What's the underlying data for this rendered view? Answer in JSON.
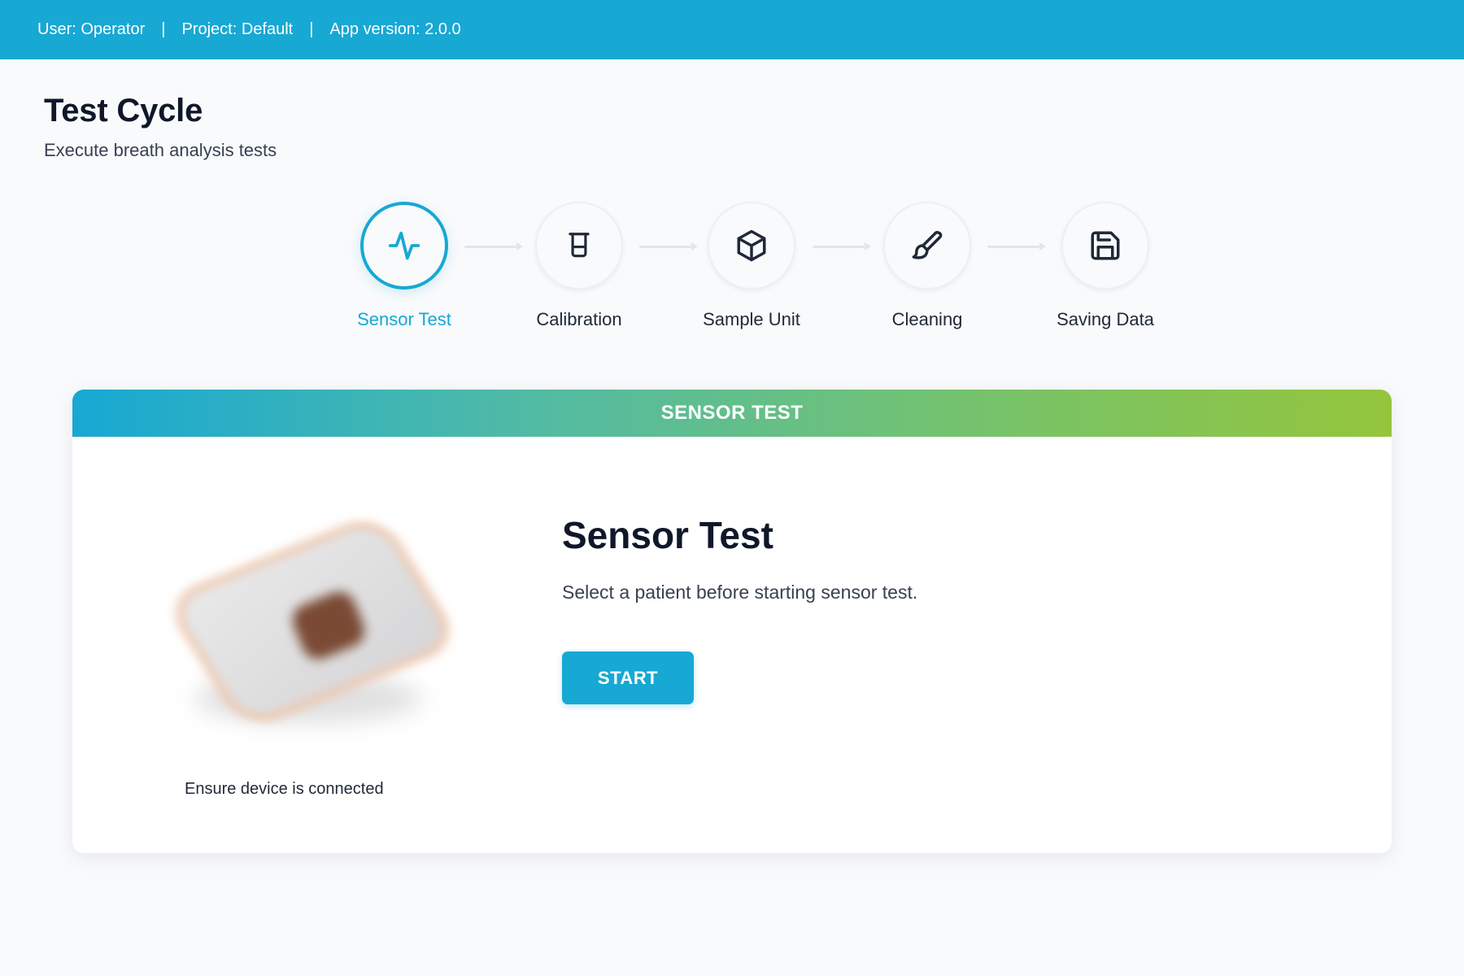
{
  "topbar": {
    "user": "User: Operator",
    "project": "Project: Default",
    "version": "App version: 2.0.0",
    "separator": "|"
  },
  "page": {
    "title": "Test Cycle",
    "subtitle": "Execute breath analysis tests"
  },
  "steps": [
    {
      "label": "Sensor Test",
      "icon": "activity-icon",
      "active": true
    },
    {
      "label": "Calibration",
      "icon": "beaker-icon",
      "active": false
    },
    {
      "label": "Sample Unit",
      "icon": "box-icon",
      "active": false
    },
    {
      "label": "Cleaning",
      "icon": "brush-icon",
      "active": false
    },
    {
      "label": "Saving Data",
      "icon": "save-icon",
      "active": false
    }
  ],
  "card": {
    "header": "SENSOR TEST",
    "title": "Sensor Test",
    "description": "Select a patient before starting sensor test.",
    "start_label": "START",
    "device_note": "Ensure device is connected"
  },
  "colors": {
    "accent": "#17a8d4",
    "gradient_end": "#94c53c",
    "text_dark": "#0f172a"
  }
}
